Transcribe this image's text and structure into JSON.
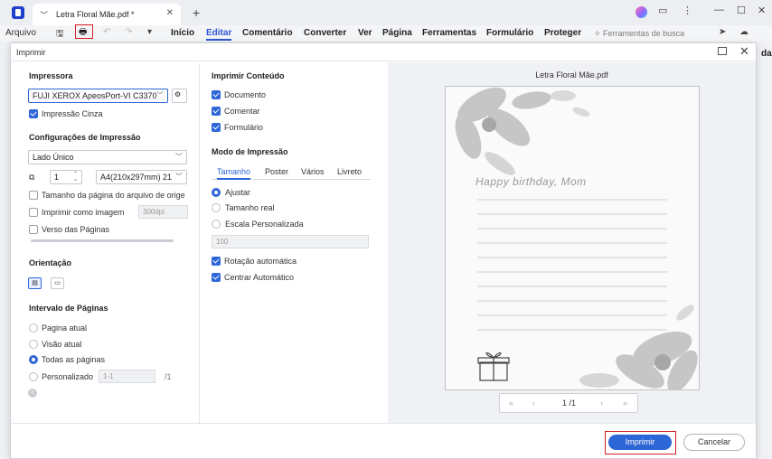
{
  "titlebar": {
    "tab_title": "Letra Floral Mãe.pdf *",
    "icons": [
      "chevron-down-icon",
      "close-icon",
      "plus-icon",
      "avatar",
      "feedback-icon",
      "more-icon",
      "minimize-icon",
      "maximize-icon",
      "close-window-icon"
    ]
  },
  "menubar": {
    "file": "Arquivo",
    "items": [
      "Início",
      "Editar",
      "Comentário",
      "Converter",
      "Ver",
      "Página",
      "Ferramentas",
      "Formulário",
      "Proteger"
    ],
    "active": "Editar",
    "search_tools": "Ferramentas de busca",
    "right_partial": "da"
  },
  "dialog": {
    "title": "Imprimir",
    "printer": {
      "section": "Impressora",
      "selected": "FUJI XEROX ApeosPort-VI C3370",
      "grayscale_label": "Impressão Cinza",
      "grayscale_checked": true
    },
    "settings": {
      "section": "Configurações de Impressão",
      "sides": "Lado Único",
      "copies": "1",
      "paper": "A4(210x297mm) 21",
      "options": [
        {
          "label": "Tamanho da página do arquivo de orige",
          "checked": false
        },
        {
          "label": "Imprimir como imagem",
          "checked": false
        },
        {
          "label": "Verso das Páginas",
          "checked": false
        }
      ],
      "dpi": "300dpi"
    },
    "orientation": {
      "section": "Orientação"
    },
    "range": {
      "section": "Intervalo de Páginas",
      "options": [
        "Pagina atual",
        "Visão atual",
        "Todas as páginas",
        "Personalizado"
      ],
      "selected": "Todas as páginas",
      "custom_value": "1-1",
      "custom_total": "/1"
    },
    "content": {
      "section": "Imprimir Conteúdo",
      "items": [
        {
          "label": "Documento",
          "checked": true
        },
        {
          "label": "Comentar",
          "checked": true
        },
        {
          "label": "Formulário",
          "checked": true
        }
      ]
    },
    "mode": {
      "section": "Modo de Impressão",
      "tabs": [
        "Tamanho",
        "Poster",
        "Vários",
        "Livreto"
      ],
      "active_tab": "Tamanho",
      "size_options": [
        "Ajustar",
        "Tamanho real",
        "Escala Personalizada"
      ],
      "selected": "Ajustar",
      "scale": "100",
      "auto_rotate": "Rotação automática",
      "auto_center": "Centrar Automático"
    },
    "preview": {
      "title": "Letra Floral Mãe.pdf",
      "greeting": "Happy birthday, Mom",
      "page_indicator": "1 /1"
    },
    "buttons": {
      "print": "Imprimir",
      "cancel": "Cancelar"
    }
  },
  "colors": {
    "accent": "#2d66d6",
    "highlight_red": "#d41e26"
  }
}
